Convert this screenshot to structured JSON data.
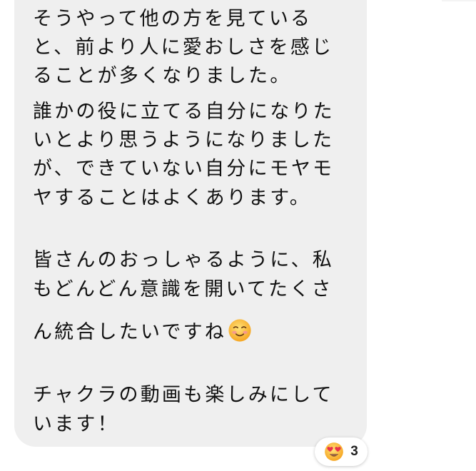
{
  "message": {
    "lines": [
      "そうやって他の方を見ている",
      "と、前より人に愛おしさを感じ",
      "ることが多くなりました。",
      "誰かの役に立てる自分になりた",
      "いとより思うようになりました",
      "が、できていない自分にモヤモ",
      "ヤすることはよくあります。",
      "",
      "皆さんのおっしゃるように、私",
      "もどんどん意識を開いてたくさ",
      "ん統合したいですね",
      "",
      "チャクラの動画も楽しみにして",
      "います！"
    ],
    "inline_emoji": "smiling-face-emoji"
  },
  "reaction": {
    "emoji": "heart-eyes-emoji",
    "count": "3"
  },
  "colors": {
    "bubble": "#efefef",
    "text": "#111111",
    "background": "#ffffff"
  }
}
